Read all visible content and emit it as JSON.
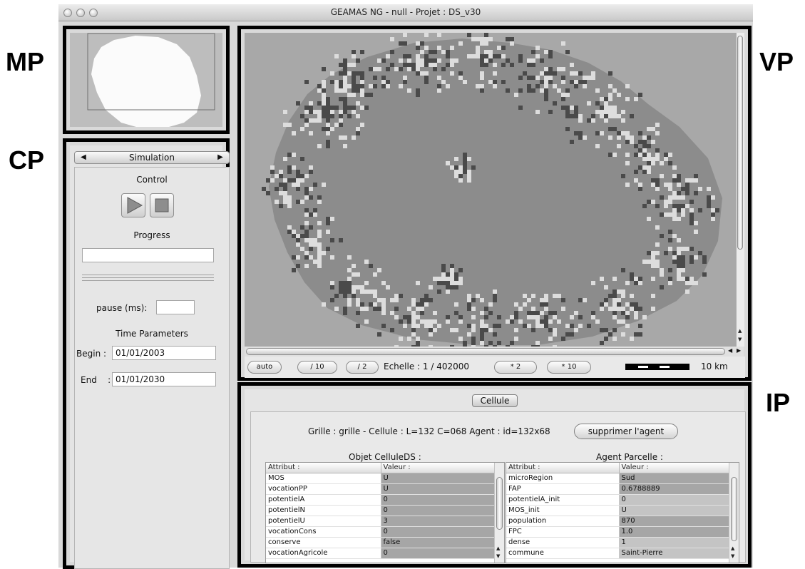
{
  "labels": {
    "mp": "MP",
    "cp": "CP",
    "vp": "VP",
    "ip": "IP"
  },
  "window": {
    "title": "GEAMAS NG - null - Projet : DS_v30"
  },
  "control_panel": {
    "tab_label": "Simulation",
    "control_heading": "Control",
    "progress_heading": "Progress",
    "pause_label": "pause (ms):",
    "pause_value": "",
    "time_heading": "Time Parameters",
    "begin_label": "Begin :",
    "begin_value": "01/01/2003",
    "end_label": "End    :",
    "end_value": "01/01/2030"
  },
  "viewport": {
    "buttons": [
      "auto",
      "/ 10",
      "/ 2",
      "* 2",
      "* 10"
    ],
    "scale_text": "Echelle : 1 / 402000",
    "scalebar_label": "10 km"
  },
  "info_panel": {
    "tab_label": "Cellule",
    "grille_text": "Grille : grille - Cellule : L=132 C=068  Agent : id=132x68",
    "delete_agent_button": "supprimer l'agent",
    "left_table": {
      "title": "Objet CelluleDS :",
      "headers": [
        "Attribut :",
        "Valeur :"
      ],
      "rows": [
        [
          "MOS",
          "U"
        ],
        [
          "vocationPP",
          "U"
        ],
        [
          "potentielA",
          "0"
        ],
        [
          "potentielN",
          "0"
        ],
        [
          "potentielU",
          "3"
        ],
        [
          "vocationCons",
          "0"
        ],
        [
          "conserve",
          "false"
        ],
        [
          "vocationAgricole",
          "0"
        ]
      ]
    },
    "right_table": {
      "title": "Agent Parcelle :",
      "headers": [
        "Attribut :",
        "Valeur :"
      ],
      "rows": [
        [
          "microRegion",
          "Sud"
        ],
        [
          "FAP",
          "0.6788889"
        ],
        [
          "potentielA_init",
          "0"
        ],
        [
          "MOS_init",
          "U"
        ],
        [
          "population",
          "870"
        ],
        [
          "FPC",
          "1.0"
        ],
        [
          "dense",
          "1"
        ],
        [
          "commune",
          "Saint-Pierre"
        ]
      ]
    }
  },
  "colors": {
    "frame": "#000000",
    "map_sea": "#a8a8a8",
    "map_land": "#8c8c8c",
    "map_dark": "#4a4a4a",
    "map_light": "#dddddd",
    "value_cell": "#a6a6a6"
  },
  "icons": {
    "play": "play-triangle-icon",
    "stop": "stop-square-icon",
    "tab_prev": "arrow-left-icon",
    "tab_next": "arrow-right-icon"
  }
}
